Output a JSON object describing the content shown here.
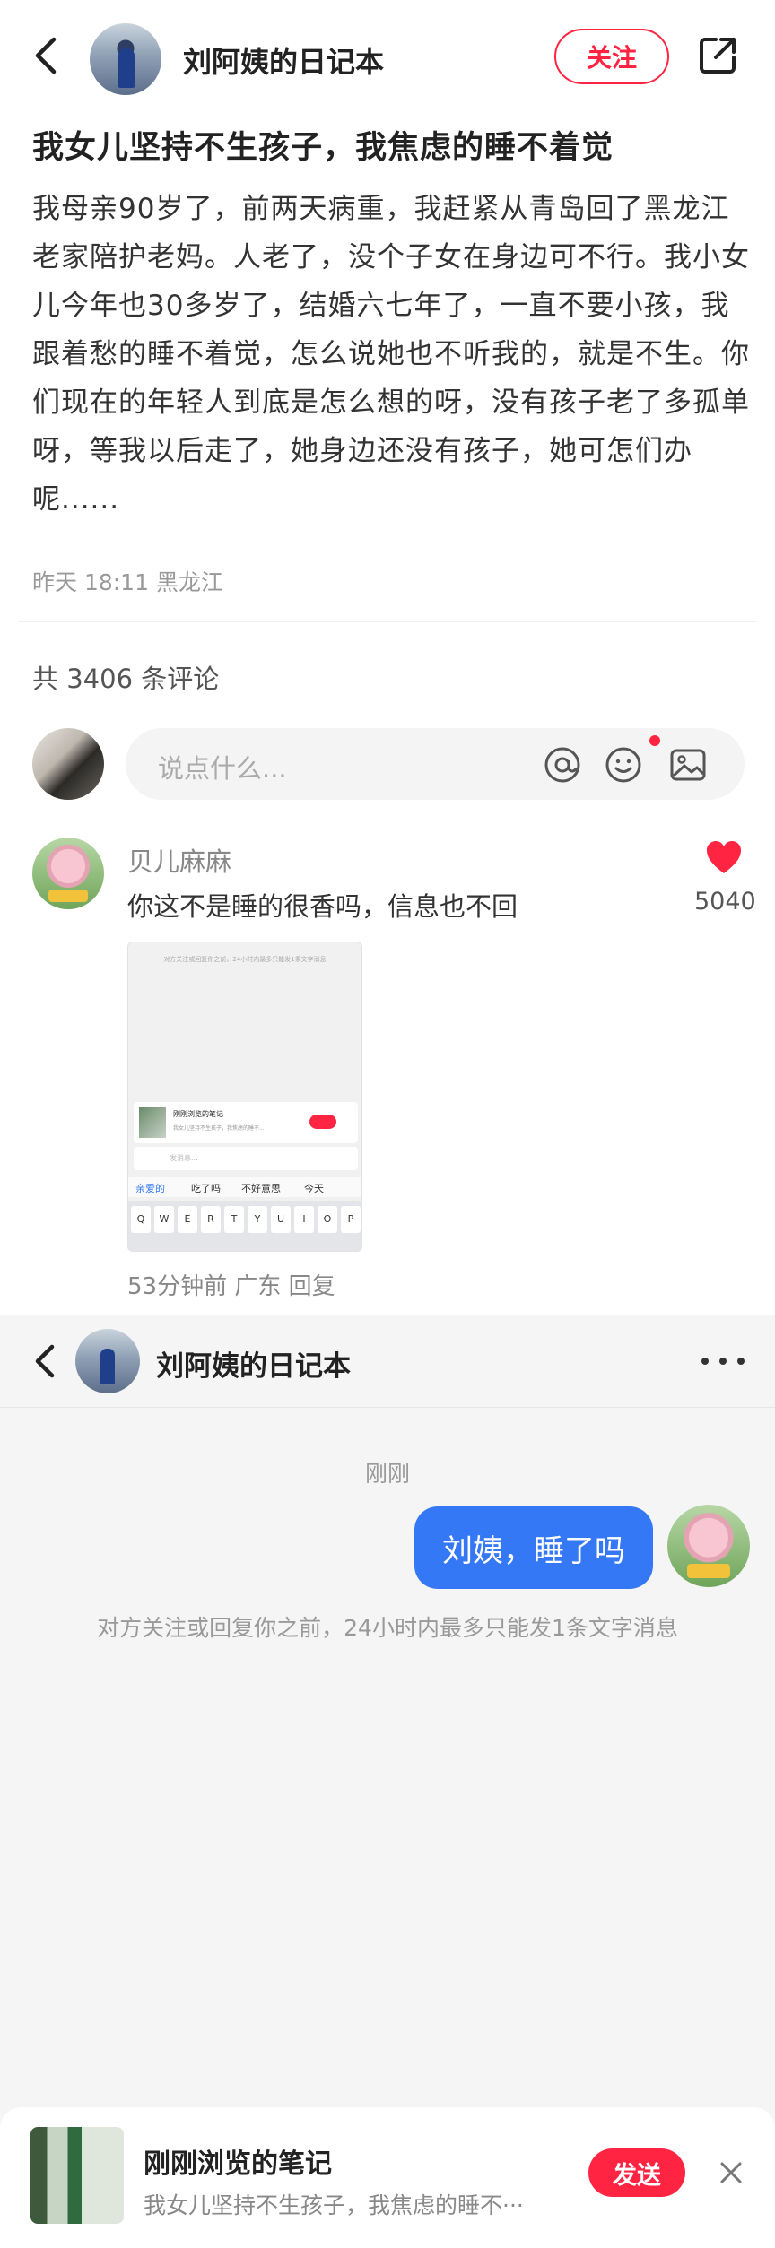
{
  "post": {
    "author_name": "刘阿姨的日记本",
    "follow_label": "关注",
    "title": "我女儿坚持不生孩子，我焦虑的睡不着觉",
    "body": "我母亲90岁了，前两天病重，我赶紧从青岛回了黑龙江老家陪护老妈。人老了，没个子女在身边可不行。我小女儿今年也30多岁了，结婚六七年了，一直不要小孩，我跟着愁的睡不着觉，怎么说她也不听我的，就是不生。你们现在的年轻人到底是怎么想的呀，没有孩子老了多孤单呀，等我以后走了，她身边还没有孩子，她可怎们办呢......",
    "meta": "昨天 18:11 黑龙江"
  },
  "comments": {
    "count_label": "共 3406 条评论",
    "input_placeholder": "说点什么...",
    "item": {
      "name": "贝儿麻麻",
      "text": "你这不是睡的很香吗，信息也不回",
      "likes": "5040",
      "meta": "53分钟前 广东 回复",
      "screenshot": {
        "top_note": "对方关注或回复你之前，24小时内最多只能发1条文字消息",
        "card_title": "刚刚浏览的笔记",
        "card_sub": "我女儿坚持不生孩子，我焦虑的睡不...",
        "input_placeholder": "发消息...",
        "suggestions": [
          "亲爱的",
          "吃了吗",
          "不好意思",
          "今天"
        ],
        "keys": [
          "Q",
          "W",
          "E",
          "R",
          "T",
          "Y",
          "U",
          "I",
          "O",
          "P"
        ]
      }
    }
  },
  "chat": {
    "name": "刘阿姨的日记本",
    "time": "刚刚",
    "message": "刘姨，睡了吗",
    "notice": "对方关注或回复你之前，24小时内最多只能发1条文字消息",
    "recent_title": "刚刚浏览的笔记",
    "recent_subtitle": "我女儿坚持不生孩子，我焦虑的睡不···",
    "send_label": "发送"
  },
  "colors": {
    "accent": "#ff2442",
    "bubble": "#3478f6"
  }
}
